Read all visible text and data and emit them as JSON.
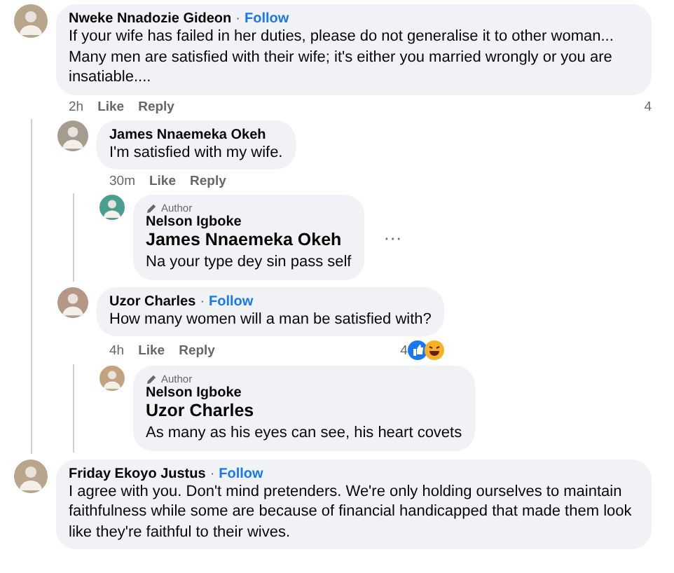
{
  "comments": [
    {
      "author": "Nweke Nnadozie Gideon",
      "separator": "·",
      "follow": "Follow",
      "text": "If your wife has failed in her duties, please do not generalise it to other woman... Many men are satisfied with their wife; it's either you married wrongly or you are insatiable....",
      "time": "2h",
      "actions": [
        "Like",
        "Reply"
      ],
      "reaction_count": "4",
      "children": [
        {
          "author": "James Nnaemeka Okeh",
          "text": "I'm satisfied with my wife.",
          "time": "30m",
          "actions": [
            "Like",
            "Reply"
          ],
          "children": [
            {
              "badge": "Author",
              "author": "Nelson Igboke",
              "mention": "James Nnaemeka Okeh",
              "text": "Na your type dey sin pass self",
              "more": "···"
            }
          ]
        },
        {
          "author": "Uzor Charles",
          "separator": "·",
          "follow": "Follow",
          "text": "How many women will a man be satisfied with?",
          "time": "4h",
          "actions": [
            "Like",
            "Reply"
          ],
          "reaction_count": "4",
          "reactions": [
            {
              "kind": "like"
            },
            {
              "kind": "haha"
            }
          ],
          "children": [
            {
              "badge": "Author",
              "author": "Nelson Igboke",
              "mention": "Uzor Charles",
              "text": "As many as his eyes can see, his heart covets"
            }
          ]
        }
      ]
    },
    {
      "author": "Friday Ekoyo Justus",
      "separator": "·",
      "follow": "Follow",
      "text": "I agree with you. Don't mind pretenders. We're only holding ourselves to maintain faithfulness while some are because of financial handicapped that made them look like they're faithful to their wives."
    }
  ]
}
